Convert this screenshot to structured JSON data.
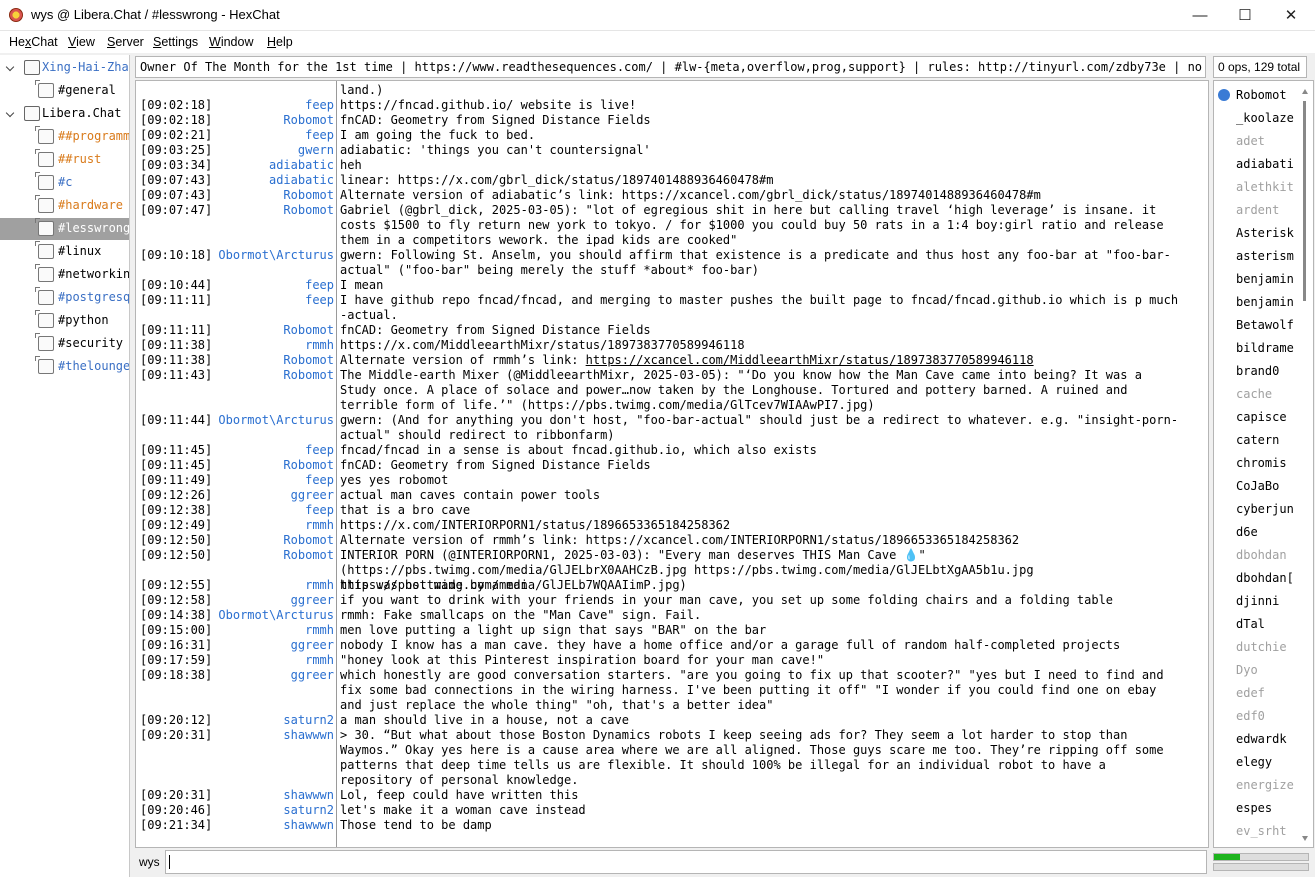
{
  "window": {
    "title": "wys @ Libera.Chat / #lesswrong - HexChat",
    "minimize": "—",
    "maximize": "☐",
    "close": "✕"
  },
  "menu": [
    "HexChat",
    "View",
    "Server",
    "Settings",
    "Window",
    "Help"
  ],
  "tree": [
    {
      "label": "Xing-Hai-Zhan",
      "type": "server",
      "color": "#3a6fc4"
    },
    {
      "label": "#general",
      "type": "channel",
      "color": "#000000"
    },
    {
      "label": "Libera.Chat",
      "type": "server",
      "color": "#000000"
    },
    {
      "label": "##programming",
      "type": "channel",
      "color": "#d97a1a"
    },
    {
      "label": "##rust",
      "type": "channel",
      "color": "#d97a1a"
    },
    {
      "label": "#c",
      "type": "channel",
      "color": "#3a6fc4"
    },
    {
      "label": "#hardware",
      "type": "channel",
      "color": "#d97a1a"
    },
    {
      "label": "#lesswrong",
      "type": "channel",
      "color": "#ffffff",
      "selected": true
    },
    {
      "label": "#linux",
      "type": "channel",
      "color": "#000000"
    },
    {
      "label": "#networking",
      "type": "channel",
      "color": "#000000"
    },
    {
      "label": "#postgresql",
      "type": "channel",
      "color": "#3a6fc4"
    },
    {
      "label": "#python",
      "type": "channel",
      "color": "#000000"
    },
    {
      "label": "#security",
      "type": "channel",
      "color": "#000000"
    },
    {
      "label": "#thelounge",
      "type": "channel",
      "color": "#3a6fc4"
    }
  ],
  "topic": "Owner Of The Month for the 1st time | https://www.readthesequences.com/ | #lw-{meta,overflow,prog,support} | rules: http://tinyurl.com/zdby73e | no logs",
  "usercount": "0 ops, 129 total",
  "messages": [
    {
      "ts": "",
      "nick": "",
      "text": "land.)",
      "lines": 1
    },
    {
      "ts": "[09:02:18]",
      "nick": "feep",
      "text": "https://fncad.github.io/ website is live!",
      "lines": 1
    },
    {
      "ts": "[09:02:18]",
      "nick": "Robomot",
      "text": "fnCAD: Geometry from Signed Distance Fields",
      "lines": 1
    },
    {
      "ts": "[09:02:21]",
      "nick": "feep",
      "text": "I am going the fuck to bed.",
      "lines": 1
    },
    {
      "ts": "[09:03:25]",
      "nick": "gwern",
      "text": "adiabatic: 'things you can't countersignal'",
      "lines": 1
    },
    {
      "ts": "[09:03:34]",
      "nick": "adiabatic",
      "text": "heh",
      "lines": 1
    },
    {
      "ts": "[09:07:43]",
      "nick": "adiabatic",
      "text": "linear: https://x.com/gbrl_dick/status/1897401488936460478#m",
      "lines": 1
    },
    {
      "ts": "[09:07:43]",
      "nick": "Robomot",
      "text": "Alternate version of adiabatic’s link: https://xcancel.com/gbrl_dick/status/1897401488936460478#m",
      "lines": 1
    },
    {
      "ts": "[09:07:47]",
      "nick": "Robomot",
      "text": "Gabriel (@gbrl_dick, 2025-03-05): \"lot of egregious shit in here but calling travel ‘high leverage’ is insane. it costs $1500 to fly return new york to tokyo. / for $1000 you could buy 50 rats in a 1:4 boy:girl ratio and release them in a competitors wework. the ipad kids are cooked\"",
      "lines": 3
    },
    {
      "ts": "[09:10:18]",
      "nick": "Obormot\\Arcturus",
      "text": "gwern: Following St. Anselm, you should affirm that existence is a predicate and thus host any foo-bar at \"foo-bar-actual\" (\"foo-bar\" being merely the stuff *about* foo-bar)",
      "lines": 2
    },
    {
      "ts": "[09:10:44]",
      "nick": "feep",
      "text": "I mean",
      "lines": 1
    },
    {
      "ts": "[09:11:11]",
      "nick": "feep",
      "text": "I have github repo fncad/fncad, and merging to master pushes the built page to fncad/fncad.github.io which is p much -actual.",
      "lines": 2
    },
    {
      "ts": "[09:11:11]",
      "nick": "Robomot",
      "text": "fnCAD: Geometry from Signed Distance Fields",
      "lines": 1
    },
    {
      "ts": "[09:11:38]",
      "nick": "rmmh",
      "text": "https://x.com/MiddleearthMixr/status/1897383770589946118",
      "lines": 1
    },
    {
      "ts": "[09:11:38]",
      "nick": "Robomot",
      "text": "Alternate version of rmmh’s link: https://xcancel.com/MiddleearthMixr/status/1897383770589946118",
      "lines": 1,
      "underline_from": 34
    },
    {
      "ts": "[09:11:43]",
      "nick": "Robomot",
      "text": "The Middle-earth Mixer (@MiddleearthMixr, 2025-03-05): \"‘Do you know how the Man Cave came into being? It was a Study once. A place of solace and power…now taken by the Longhouse. Tortured and pottery barned. A ruined and terrible form of life.’\" (https://pbs.twimg.com/media/GlTcev7WIAAwPI7.jpg)",
      "lines": 3
    },
    {
      "ts": "[09:11:44]",
      "nick": "Obormot\\Arcturus",
      "text": "gwern: (And for anything you don't host, \"foo-bar-actual\" should just be a redirect to whatever. e.g. \"insight-porn-actual\" should redirect to ribbonfarm)",
      "lines": 2
    },
    {
      "ts": "[09:11:45]",
      "nick": "feep",
      "text": "fncad/fncad in a sense is about fncad.github.io, which also exists",
      "lines": 1
    },
    {
      "ts": "[09:11:45]",
      "nick": "Robomot",
      "text": "fnCAD: Geometry from Signed Distance Fields",
      "lines": 1
    },
    {
      "ts": "[09:11:49]",
      "nick": "feep",
      "text": "yes yes robomot",
      "lines": 1
    },
    {
      "ts": "[09:12:26]",
      "nick": "ggreer",
      "text": "actual man caves contain power tools",
      "lines": 1
    },
    {
      "ts": "[09:12:38]",
      "nick": "feep",
      "text": "that is a bro cave",
      "lines": 1
    },
    {
      "ts": "[09:12:49]",
      "nick": "rmmh",
      "text": "https://x.com/INTERIORPORN1/status/1896653365184258362",
      "lines": 1
    },
    {
      "ts": "[09:12:50]",
      "nick": "Robomot",
      "text": "Alternate version of rmmh’s link: https://xcancel.com/INTERIORPORN1/status/1896653365184258362",
      "lines": 1
    },
    {
      "ts": "[09:12:50]",
      "nick": "Robomot",
      "text": "INTERIOR PORN (@INTERIORPORN1, 2025-03-03): \"Every man deserves THIS Man Cave 💧\" (https://pbs.twimg.com/media/GlJELbrX0AAHCzB.jpg https://pbs.twimg.com/media/GlJELbtXgAA5b1u.jpg https://pbs.twimg.com/media/GlJELb7WQAAIimP.jpg)",
      "lines": 2
    },
    {
      "ts": "[09:12:55]",
      "nick": "rmmh",
      "text": "this was not made by a man",
      "lines": 1
    },
    {
      "ts": "[09:12:58]",
      "nick": "ggreer",
      "text": "if you want to drink with your friends in your man cave, you set up some folding chairs and a folding table",
      "lines": 1
    },
    {
      "ts": "[09:14:38]",
      "nick": "Obormot\\Arcturus",
      "text": "rmmh: Fake smallcaps on the \"Man Cave\" sign. Fail.",
      "lines": 1
    },
    {
      "ts": "[09:15:00]",
      "nick": "rmmh",
      "text": "men love putting a light up sign that says \"BAR\" on the bar",
      "lines": 1
    },
    {
      "ts": "[09:16:31]",
      "nick": "ggreer",
      "text": "nobody I know has a man cave. they have a home office and/or a garage full of random half-completed projects",
      "lines": 1
    },
    {
      "ts": "[09:17:59]",
      "nick": "rmmh",
      "text": "\"honey look at this Pinterest inspiration board for your man cave!\"",
      "lines": 1
    },
    {
      "ts": "[09:18:38]",
      "nick": "ggreer",
      "text": "which honestly are good conversation starters. \"are you going to fix up that scooter?\" \"yes but I need to find and fix some bad connections in the wiring harness. I've been putting it off\" \"I wonder if you could find one on ebay and just replace the whole thing\" \"oh, that's a better idea\"",
      "lines": 3
    },
    {
      "ts": "[09:20:12]",
      "nick": "saturn2",
      "text": "a man should live in a house, not a cave",
      "lines": 1
    },
    {
      "ts": "[09:20:31]",
      "nick": "shawwwn",
      "text": "> 30. “But what about those Boston Dynamics robots I keep seeing ads for? They seem a lot harder to stop than Waymos.” Okay yes here is a cause area where we are all aligned. Those guys scare me too. They’re ripping off some patterns that deep time tells us are flexible. It should 100% be illegal for an individual robot to have a repository of personal knowledge.",
      "lines": 4
    },
    {
      "ts": "[09:20:31]",
      "nick": "shawwwn",
      "text": "Lol, feep could have written this",
      "lines": 1
    },
    {
      "ts": "[09:20:46]",
      "nick": "saturn2",
      "text": "let's make it a woman cave instead",
      "lines": 1
    },
    {
      "ts": "[09:21:34]",
      "nick": "shawwwn",
      "text": "Those tend to be damp",
      "lines": 1
    }
  ],
  "nick_colors": {
    "feep": "#2a6fd0",
    "Robomot": "#2a6fd0",
    "gwern": "#2a6fd0",
    "adiabatic": "#2a6fd0",
    "Obormot\\Arcturus": "#2a6fd0",
    "rmmh": "#2a6fd0",
    "ggreer": "#2a6fd0",
    "saturn2": "#2a6fd0",
    "shawwwn": "#2a6fd0"
  },
  "users": [
    {
      "name": "Robomot",
      "away": false,
      "op": true
    },
    {
      "name": "_koolaze",
      "away": false
    },
    {
      "name": "adet",
      "away": true
    },
    {
      "name": "adiabati",
      "away": false
    },
    {
      "name": "alethkit",
      "away": true
    },
    {
      "name": "ardent",
      "away": true
    },
    {
      "name": "Asterisk",
      "away": false
    },
    {
      "name": "asterism",
      "away": false
    },
    {
      "name": "benjamin",
      "away": false
    },
    {
      "name": "benjamin",
      "away": false
    },
    {
      "name": "Betawolf",
      "away": false
    },
    {
      "name": "bildrame",
      "away": false
    },
    {
      "name": "brand0",
      "away": false
    },
    {
      "name": "cache",
      "away": true
    },
    {
      "name": "capisce",
      "away": false
    },
    {
      "name": "catern",
      "away": false
    },
    {
      "name": "chromis",
      "away": false
    },
    {
      "name": "CoJaBo",
      "away": false
    },
    {
      "name": "cyberjun",
      "away": false
    },
    {
      "name": "d6e",
      "away": false
    },
    {
      "name": "dbohdan",
      "away": true
    },
    {
      "name": "dbohdan[",
      "away": false
    },
    {
      "name": "djinni",
      "away": false
    },
    {
      "name": "dTal",
      "away": false
    },
    {
      "name": "dutchie",
      "away": true
    },
    {
      "name": "Dyo",
      "away": true
    },
    {
      "name": "edef",
      "away": true
    },
    {
      "name": "edf0",
      "away": true
    },
    {
      "name": "edwardk",
      "away": false
    },
    {
      "name": "elegy",
      "away": false
    },
    {
      "name": "energize",
      "away": true
    },
    {
      "name": "espes",
      "away": false
    },
    {
      "name": "ev_srht",
      "away": true
    }
  ],
  "input": {
    "nick": "wys",
    "value": ""
  },
  "lag_fraction": 0.28
}
